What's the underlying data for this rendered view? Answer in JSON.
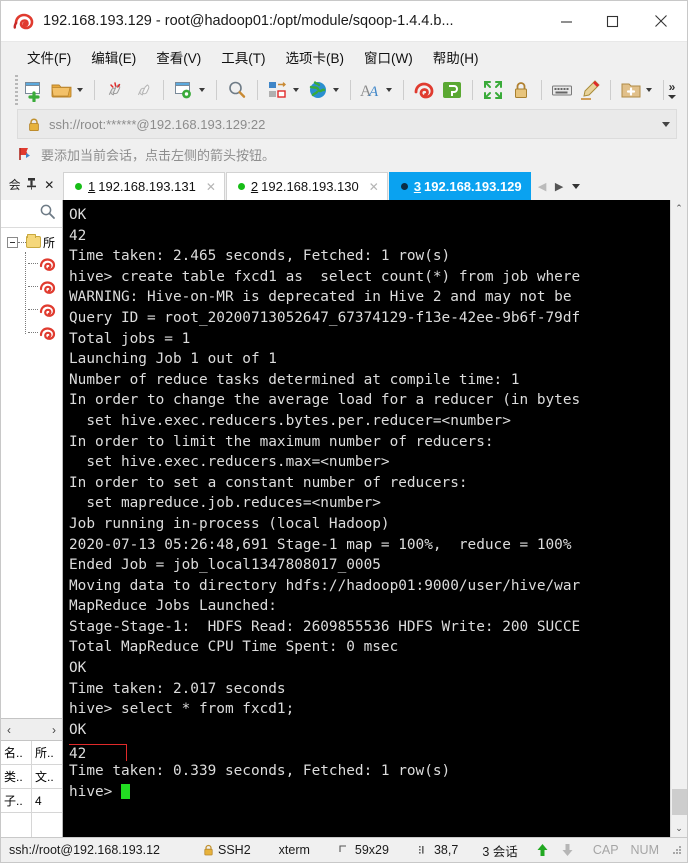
{
  "window": {
    "title": "192.168.193.129 - root@hadoop01:/opt/module/sqoop-1.4.4.b...",
    "app_icon": "xshell-snail-icon",
    "minimize_label": "─",
    "maximize_label": "☐",
    "close_label": "✕"
  },
  "menubar": {
    "items": [
      {
        "label": "文件(F)",
        "name": "menu-file"
      },
      {
        "label": "编辑(E)",
        "name": "menu-edit"
      },
      {
        "label": "查看(V)",
        "name": "menu-view"
      },
      {
        "label": "工具(T)",
        "name": "menu-tools"
      },
      {
        "label": "选项卡(B)",
        "name": "menu-tabs"
      },
      {
        "label": "窗口(W)",
        "name": "menu-window"
      },
      {
        "label": "帮助(H)",
        "name": "menu-help"
      }
    ]
  },
  "toolbar": {
    "icons": [
      "new-session-icon",
      "open-folder-icon",
      "open-folder-caret",
      "separator",
      "disconnect-icon",
      "reconnect-icon",
      "separator",
      "session-properties-icon",
      "session-properties-caret",
      "separator",
      "find-icon",
      "separator",
      "file-transfer-icon",
      "file-transfer-caret",
      "globe-icon",
      "globe-caret",
      "separator",
      "font-icon",
      "font-caret",
      "separator",
      "xshell-icon",
      "xftp-icon",
      "separator",
      "fullscreen-icon",
      "lock-icon",
      "separator",
      "keyboard-icon",
      "highlight-pen-icon",
      "separator",
      "add-to-folder-icon",
      "add-to-folder-caret",
      "separator"
    ],
    "overflow_label": "»"
  },
  "address_bar": {
    "icon": "lock-icon",
    "value": "ssh://root:******@192.168.193.129:22",
    "placeholder": "ssh://",
    "dropdown": "chevron-down-icon"
  },
  "notice_bar": {
    "icon": "red-flag-icon",
    "text": "要添加当前会话，点击左侧的箭头按钮。"
  },
  "tab_bar": {
    "tools": [
      {
        "label": "会",
        "name": "sessions-panel-toggle"
      },
      {
        "label": "⚕",
        "name": "pin-button"
      },
      {
        "label": "✕",
        "name": "close-panel-button"
      }
    ],
    "tabs": [
      {
        "num": "1",
        "label": "192.168.193.131",
        "active": false,
        "status": "connected"
      },
      {
        "num": "2",
        "label": "192.168.193.130",
        "active": false,
        "status": "connected"
      },
      {
        "num": "3",
        "label": "192.168.193.129",
        "active": true,
        "status": "connected"
      }
    ],
    "nav": {
      "prev": "◀",
      "next": "▶",
      "list": "chevron-down-icon"
    },
    "close_glyph": "✕"
  },
  "sidebar": {
    "search_icon": "search-icon",
    "tree": {
      "root_label": "所",
      "root_icon": "folder-icon",
      "expander": "collapse-icon",
      "children": [
        {
          "icon": "session-snail-icon",
          "name": "session-item-1"
        },
        {
          "icon": "session-snail-icon",
          "name": "session-item-2"
        },
        {
          "icon": "session-snail-icon",
          "name": "session-item-3"
        },
        {
          "icon": "session-snail-icon",
          "name": "session-item-4"
        }
      ]
    },
    "panel_nav": {
      "left": "‹",
      "right": "›"
    },
    "properties": [
      {
        "key": "名..",
        "value": "所.."
      },
      {
        "key": "类..",
        "value": "文.."
      },
      {
        "key": "子..",
        "value": "4"
      }
    ]
  },
  "terminal": {
    "lines": [
      "OK",
      "42",
      "Time taken: 2.465 seconds, Fetched: 1 row(s)",
      "hive> create table fxcd1 as  select count(*) from job where",
      "WARNING: Hive-on-MR is deprecated in Hive 2 and may not be",
      "Query ID = root_20200713052647_67374129-f13e-42ee-9b6f-79df",
      "Total jobs = 1",
      "Launching Job 1 out of 1",
      "Number of reduce tasks determined at compile time: 1",
      "In order to change the average load for a reducer (in bytes",
      "  set hive.exec.reducers.bytes.per.reducer=<number>",
      "In order to limit the maximum number of reducers:",
      "  set hive.exec.reducers.max=<number>",
      "In order to set a constant number of reducers:",
      "  set mapreduce.job.reduces=<number>",
      "Job running in-process (local Hadoop)",
      "2020-07-13 05:26:48,691 Stage-1 map = 100%,  reduce = 100%",
      "Ended Job = job_local1347808017_0005",
      "Moving data to directory hdfs://hadoop01:9000/user/hive/war",
      "MapReduce Jobs Launched:",
      "Stage-Stage-1:  HDFS Read: 2609855536 HDFS Write: 200 SUCCE",
      "Total MapReduce CPU Time Spent: 0 msec",
      "OK",
      "Time taken: 2.017 seconds",
      "hive> select * from fxcd1;",
      "OK"
    ],
    "highlighted_value": "42",
    "lines_after": [
      "Time taken: 0.339 seconds, Fetched: 1 row(s)"
    ],
    "prompt": "hive> ",
    "cursor": "block-cursor",
    "highlight_color": "#e02a2a",
    "fg_color": "#dcdcdc",
    "bg_color": "#000000"
  },
  "scrollbar": {
    "up": "⌃",
    "down": "⌄",
    "name": "terminal-vertical-scrollbar"
  },
  "status_bar": {
    "connection": "ssh://root@192.168.193.12",
    "protocol": "SSH2",
    "protocol_icon": "lock-icon",
    "terminal_type": "xterm",
    "size_icon": "resize-icon",
    "size": "59x29",
    "cursor_icon": "cursor-pos-icon",
    "cursor_pos": "38,7",
    "sessions": "3 会话",
    "upload_icon": "arrow-up-icon",
    "download_icon": "arrow-down-icon",
    "caps": "CAP",
    "num": "NUM"
  },
  "colors": {
    "accent": "#0aa2f0",
    "connected_dot": "#17bd17",
    "terminal_bg": "#000000",
    "highlight_box": "#e02a2a",
    "cursor_green": "#22dd22"
  }
}
